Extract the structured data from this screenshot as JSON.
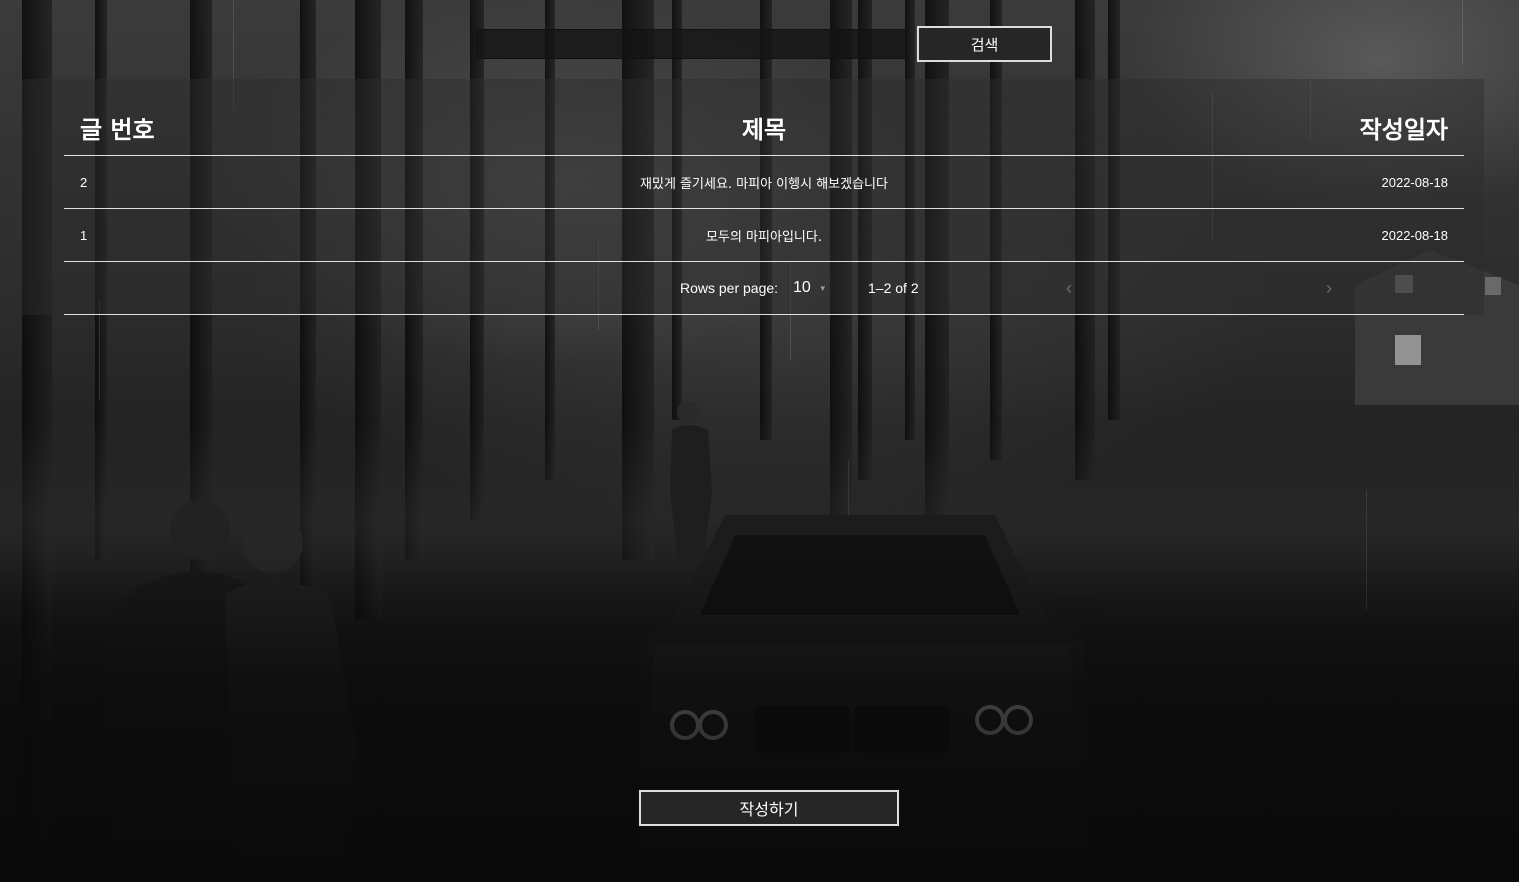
{
  "search": {
    "value": "",
    "button_label": "검색"
  },
  "table": {
    "headers": {
      "number": "글 번호",
      "title": "제목",
      "date": "작성일자"
    },
    "rows": [
      {
        "number": "2",
        "title": "재밌게 즐기세요. 마피아 이헹시 해보겠습니다",
        "date": "2022-08-18"
      },
      {
        "number": "1",
        "title": "모두의 마피아입니다.",
        "date": "2022-08-18"
      }
    ]
  },
  "pagination": {
    "rows_per_page_label": "Rows per page:",
    "rows_per_page_value": "10",
    "range_text": "1–2 of 2"
  },
  "write_button_label": "작성하기",
  "icons": {
    "prev": "chevron-left-icon",
    "next": "chevron-right-icon",
    "dropdown": "caret-down-icon"
  }
}
